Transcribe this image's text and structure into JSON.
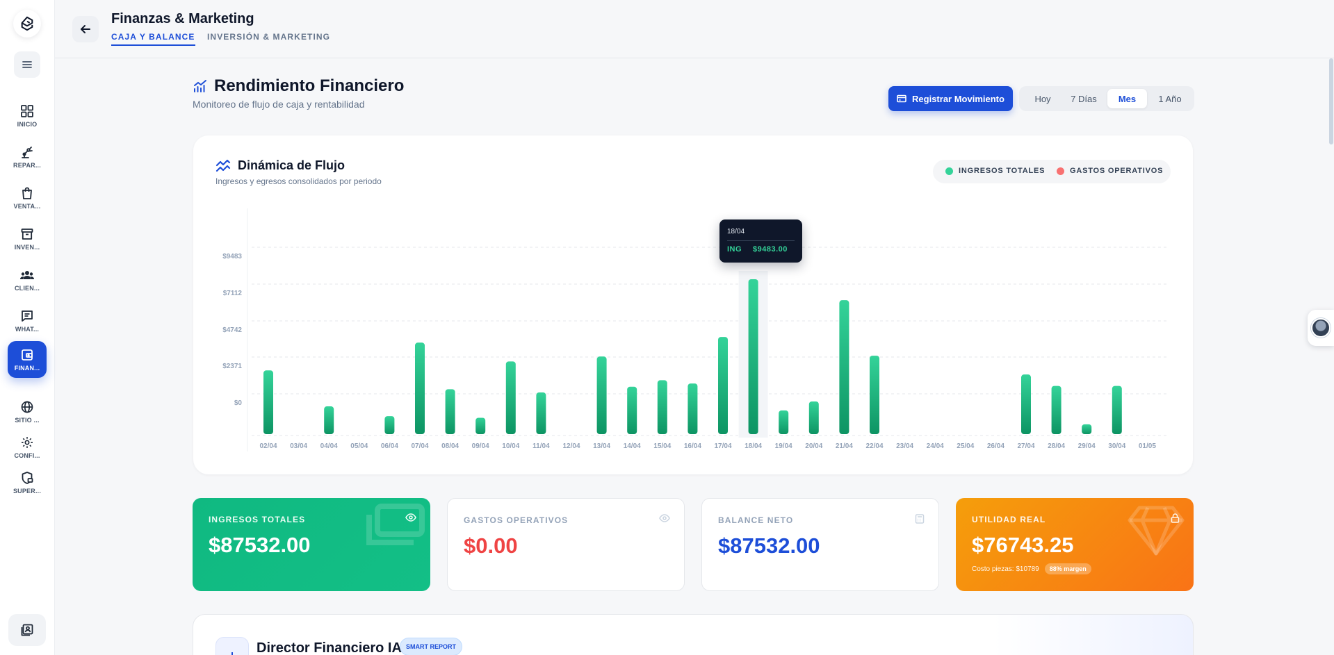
{
  "sidebar": {
    "items": [
      {
        "label": "INICIO",
        "icon": "grid-icon"
      },
      {
        "label": "REPAR...",
        "icon": "robot-arm-icon"
      },
      {
        "label": "VENTA...",
        "icon": "bag-icon"
      },
      {
        "label": "INVEN...",
        "icon": "archive-icon"
      },
      {
        "label": "CLIEN...",
        "icon": "users-icon"
      },
      {
        "label": "WHAT...",
        "icon": "chat-icon"
      },
      {
        "label": "FINAN...",
        "icon": "wallet-icon",
        "active": true
      },
      {
        "label": "SITIO ...",
        "icon": "globe-icon"
      },
      {
        "label": "CONFI...",
        "icon": "gear-icon"
      },
      {
        "label": "SUPER...",
        "icon": "shield-lock-icon"
      }
    ]
  },
  "header": {
    "title": "Finanzas & Marketing",
    "tabs": [
      {
        "label": "CAJA Y BALANCE",
        "active": true
      },
      {
        "label": "INVERSIÓN & MARKETING",
        "active": false
      }
    ]
  },
  "section": {
    "title": "Rendimiento Financiero",
    "subtitle": "Monitoreo de flujo de caja y rentabilidad",
    "primary_button": "Registrar Movimiento",
    "ranges": [
      "Hoy",
      "7 Días",
      "Mes",
      "1 Año"
    ],
    "active_range": "Mes"
  },
  "chart": {
    "title": "Dinámica de Flujo",
    "subtitle": "Ingresos y egresos consolidados por periodo",
    "legend": [
      "INGRESOS TOTALES",
      "GASTOS OPERATIVOS"
    ],
    "tooltip": {
      "date": "18/04",
      "label": "ING",
      "value": "$9483.00"
    }
  },
  "chart_data": {
    "type": "bar",
    "categories": [
      "02/04",
      "03/04",
      "04/04",
      "05/04",
      "06/04",
      "07/04",
      "08/04",
      "09/04",
      "10/04",
      "11/04",
      "12/04",
      "13/04",
      "14/04",
      "15/04",
      "16/04",
      "17/04",
      "18/04",
      "19/04",
      "20/04",
      "21/04",
      "22/04",
      "23/04",
      "24/04",
      "25/04",
      "26/04",
      "27/04",
      "28/04",
      "29/04",
      "30/04",
      "01/05"
    ],
    "series": [
      {
        "name": "INGRESOS TOTALES",
        "color": "#10b981",
        "values": [
          3900,
          0,
          1700,
          0,
          1100,
          5600,
          2750,
          1000,
          4450,
          2550,
          0,
          4750,
          2900,
          3300,
          3100,
          5950,
          9483,
          1450,
          2000,
          8200,
          4800,
          0,
          0,
          0,
          0,
          3650,
          2950,
          600,
          2950,
          0
        ]
      },
      {
        "name": "GASTOS OPERATIVOS",
        "color": "#f87171",
        "values": [
          0,
          0,
          0,
          0,
          0,
          0,
          0,
          0,
          0,
          0,
          0,
          0,
          0,
          0,
          0,
          0,
          0,
          0,
          0,
          0,
          0,
          0,
          0,
          0,
          0,
          0,
          0,
          0,
          0,
          0
        ]
      }
    ],
    "y_ticks": [
      "$9483",
      "$7112",
      "$4742",
      "$2371",
      "$0"
    ],
    "ylim": [
      0,
      9483
    ],
    "grid": true,
    "legend_position": "top-right",
    "highlight_index": 16
  },
  "stats": [
    {
      "label": "INGRESOS TOTALES",
      "value": "$87532.00",
      "icon": "eye-icon"
    },
    {
      "label": "GASTOS OPERATIVOS",
      "value": "$0.00",
      "icon": "eye-icon"
    },
    {
      "label": "BALANCE NETO",
      "value": "$87532.00",
      "icon": "calculator-icon"
    },
    {
      "label": "UTILIDAD REAL",
      "value": "$76743.25",
      "icon": "lock-icon",
      "footnote": "Costo piezas: $10789",
      "badge": "88% margen"
    }
  ],
  "ai_panel": {
    "title": "Director Financiero IA",
    "badge": "SMART REPORT"
  },
  "colors": {
    "primary": "#1d4ed8",
    "income": "#10b981",
    "expense": "#ef4444",
    "profit_start": "#f59e0b",
    "profit_end": "#f97316"
  }
}
